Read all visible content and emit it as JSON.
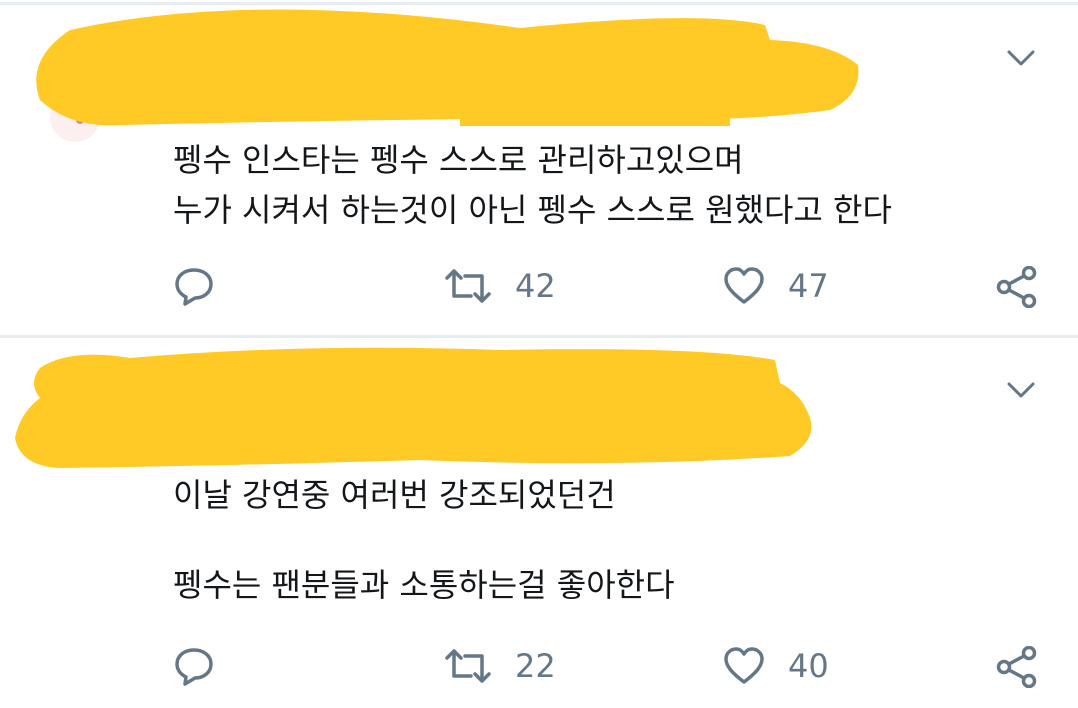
{
  "tweets": [
    {
      "text_lines": [
        "펭수 인스타는 펭수 스스로 관리하고있으며",
        "누가 시켜서 하는것이 아닌 펭수 스스로 원했다고 한다"
      ],
      "actions": {
        "reply_icon": "reply-icon",
        "retweet_icon": "retweet-icon",
        "retweet_count": "42",
        "like_icon": "heart-icon",
        "like_count": "47",
        "share_icon": "share-icon"
      },
      "menu_icon": "chevron-down-icon"
    },
    {
      "text_lines": [
        "이날 강연중 여러번 강조되었던건",
        "",
        "펭수는 팬분들과 소통하는걸 좋아한다"
      ],
      "actions": {
        "reply_icon": "reply-icon",
        "retweet_icon": "retweet-icon",
        "retweet_count": "22",
        "like_icon": "heart-icon",
        "like_count": "40",
        "share_icon": "share-icon"
      },
      "menu_icon": "chevron-down-icon"
    }
  ],
  "colors": {
    "redaction": "#ffc926",
    "text": "#14171a",
    "secondary": "#657786",
    "divider": "#e6ecf0"
  }
}
